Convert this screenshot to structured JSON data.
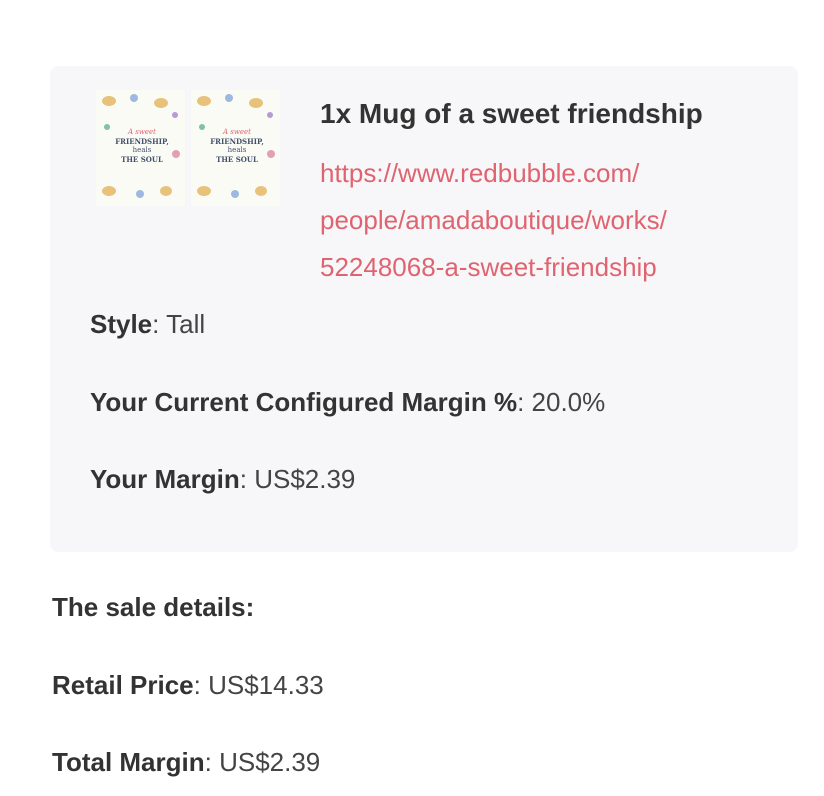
{
  "item": {
    "title": "1x Mug of a sweet friendship",
    "link_lines": [
      "https://www.redbubble.com/",
      "people/amadaboutique/works/",
      "52248068-a-sweet-friendship"
    ],
    "thumbnail_text": [
      "A sweet",
      "FRIENDSHIP,",
      "heals",
      "THE SOUL"
    ],
    "style_label": "Style",
    "style_value": "Tall",
    "configured_margin_label": "Your Current Configured Margin %",
    "configured_margin_value": "20.0%",
    "margin_label": "Your Margin",
    "margin_value": "US$2.39"
  },
  "sale": {
    "heading": "The sale details:",
    "retail_label": "Retail Price",
    "retail_value": "US$14.33",
    "total_margin_label": "Total Margin",
    "total_margin_value": "US$2.39"
  },
  "colors": {
    "card_background": "#f7f7f9",
    "link": "#e06470",
    "text": "#333333"
  }
}
